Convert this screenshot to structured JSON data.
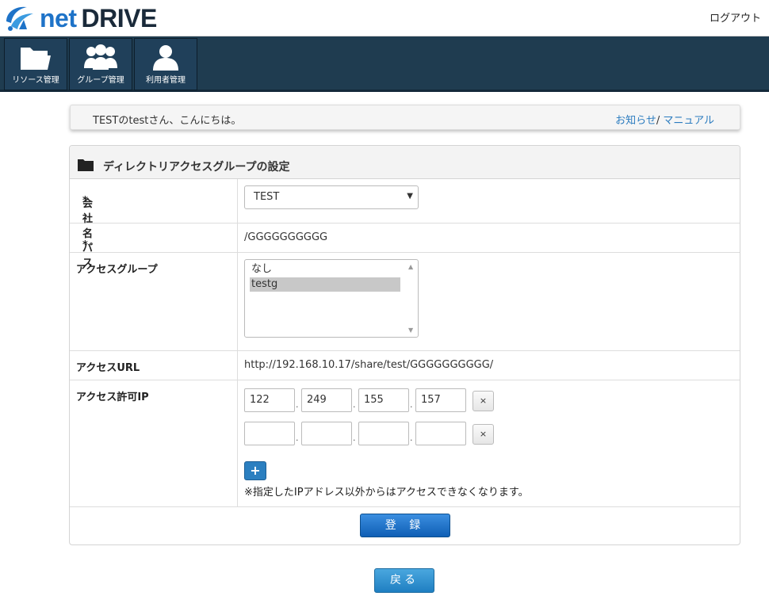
{
  "app": {
    "logo_net": "net",
    "logo_drive": "DRIVE",
    "logout_label": "ログアウト"
  },
  "nav": {
    "items": [
      {
        "label": "リソース管理",
        "icon": "folder-icon"
      },
      {
        "label": "グループ管理",
        "icon": "users-group-icon"
      },
      {
        "label": "利用者管理",
        "icon": "user-icon"
      }
    ]
  },
  "greeting": {
    "text": "TESTのtestさん、こんにちは。",
    "news_link": "お知らせ",
    "separator": "/ ",
    "manual_link": "マニュアル"
  },
  "panel": {
    "title": "ディレクトリアクセスグループの設定",
    "title_icon": "folder-icon",
    "company": {
      "label": "会社名",
      "required_mark": "*",
      "selected": "TEST"
    },
    "path": {
      "label": "パス",
      "required_mark": "*",
      "value": "/GGGGGGGGGG"
    },
    "access_group": {
      "label": "アクセスグループ",
      "options": [
        {
          "text": "なし",
          "selected": false
        },
        {
          "text": "testg",
          "selected": true
        }
      ]
    },
    "access_url": {
      "label": "アクセスURL",
      "value": "http://192.168.10.17/share/test/GGGGGGGGGG/"
    },
    "allowed_ip": {
      "label": "アクセス許可IP",
      "rows": [
        {
          "octets": [
            "122",
            "249",
            "155",
            "157"
          ],
          "remove_label": "×"
        },
        {
          "octets": [
            "",
            "",
            "",
            ""
          ],
          "remove_label": "×"
        }
      ],
      "separator": ".",
      "add_label": "+",
      "note": "※指定したIPアドレス以外からはアクセスできなくなります。"
    },
    "submit_label": "登 録"
  },
  "back_label": "戻る",
  "colors": {
    "navbar_bg": "#1f3c50",
    "link": "#2a7bbf",
    "primary_button": "#1565c0",
    "required": "#d9534f"
  }
}
